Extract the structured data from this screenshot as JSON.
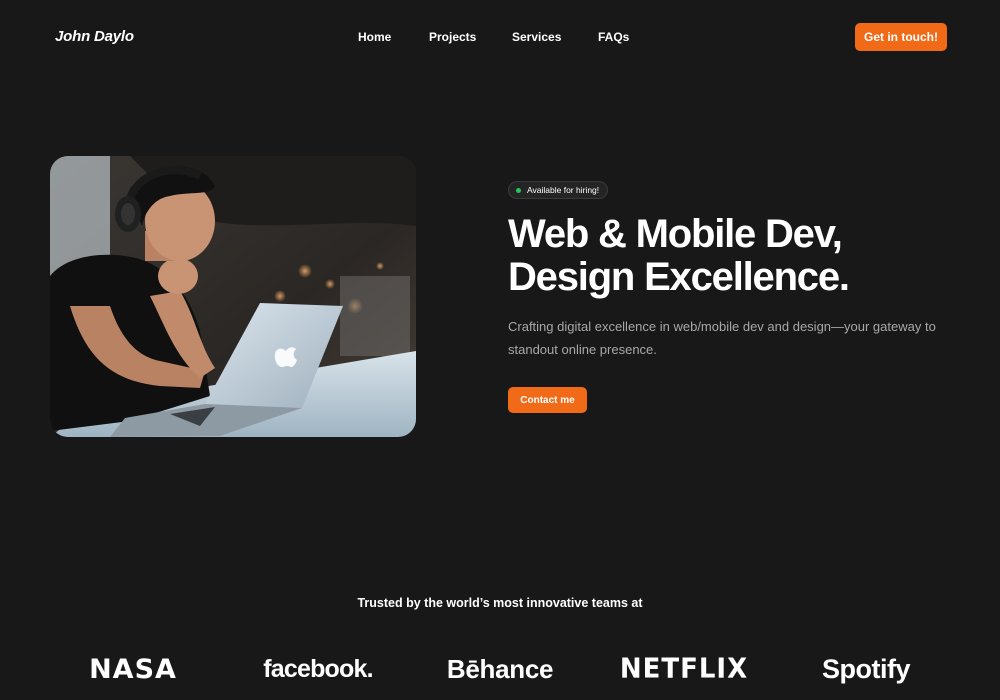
{
  "header": {
    "logo": "John Daylo",
    "nav": [
      "Home",
      "Projects",
      "Services",
      "FAQs"
    ],
    "cta_label": "Get in touch!"
  },
  "hero": {
    "badge": "Available for hiring!",
    "headline_line1": "Web & Mobile Dev,",
    "headline_line2": "Design Excellence.",
    "subtext": "Crafting digital excellence in web/mobile dev and design—your gateway to standout online presence.",
    "cta_label": "Contact me"
  },
  "trusted": {
    "title": "Trusted by the world’s most innovative teams at",
    "logos": [
      "NASA",
      "facebook.",
      "Bēhance",
      "NETFLIX",
      "Spotify"
    ]
  },
  "colors": {
    "background": "#181818",
    "accent": "#f06a18",
    "status_dot": "#22c55e",
    "muted_text": "#a8a8a8"
  }
}
